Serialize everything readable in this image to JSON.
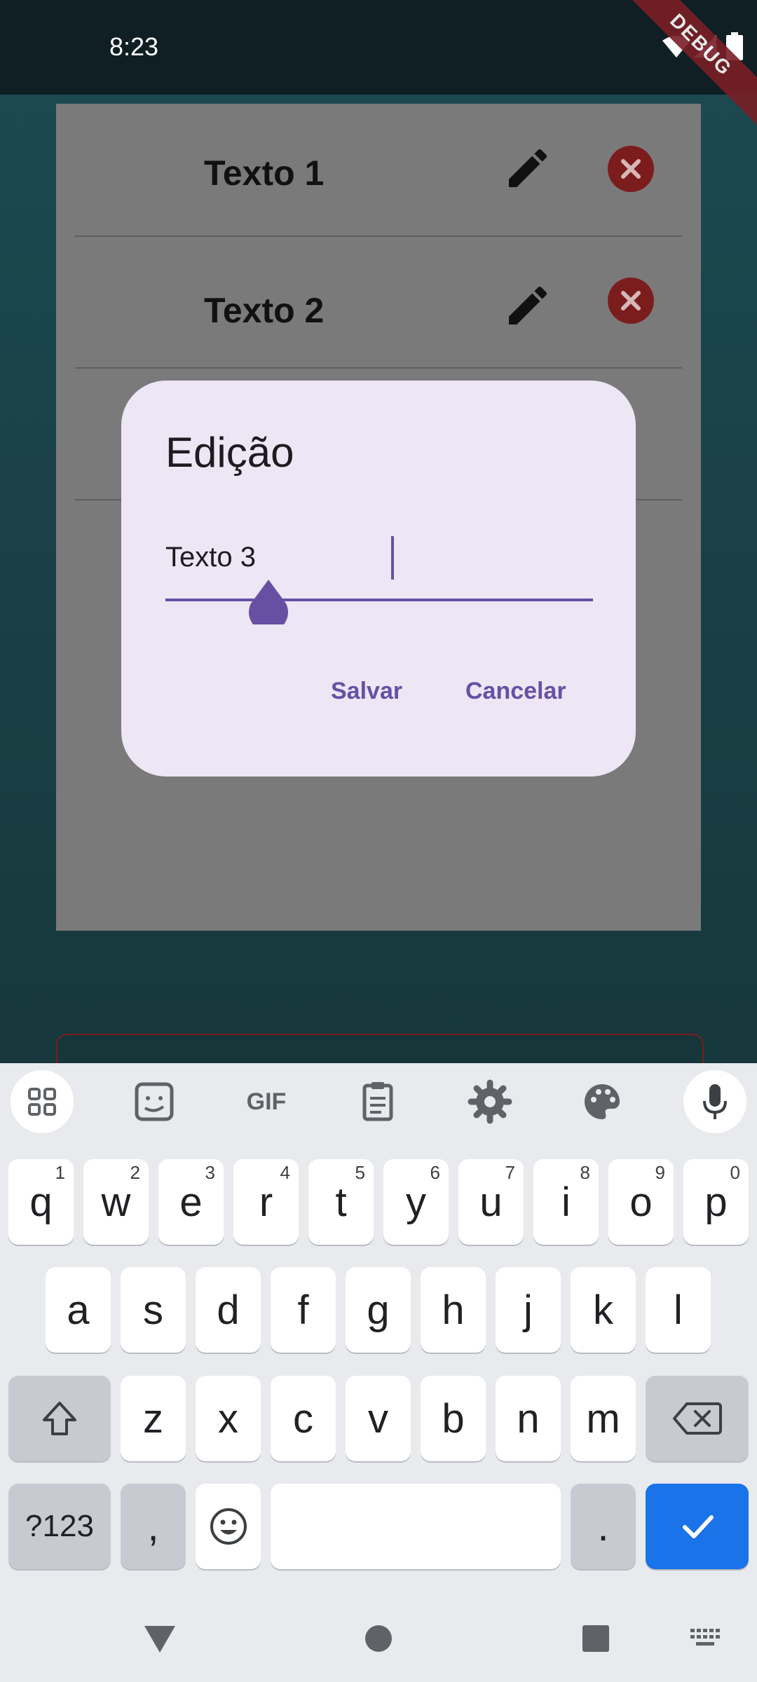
{
  "status_bar": {
    "time": "8:23",
    "debug_banner": "DEBUG"
  },
  "list": {
    "items": [
      {
        "title": "Texto 1"
      },
      {
        "title": "Texto 2"
      }
    ]
  },
  "dialog": {
    "title": "Edição",
    "input_value": "Texto 3",
    "save_label": "Salvar",
    "cancel_label": "Cancelar",
    "accent_color": "#6750a4"
  },
  "keyboard": {
    "toolbar": [
      "apps-icon",
      "sticker-icon",
      "gif-icon",
      "clipboard-icon",
      "settings-icon",
      "palette-icon",
      "mic-icon"
    ],
    "gif_label": "GIF",
    "row1": [
      {
        "key": "q",
        "hint": "1"
      },
      {
        "key": "w",
        "hint": "2"
      },
      {
        "key": "e",
        "hint": "3"
      },
      {
        "key": "r",
        "hint": "4"
      },
      {
        "key": "t",
        "hint": "5"
      },
      {
        "key": "y",
        "hint": "6"
      },
      {
        "key": "u",
        "hint": "7"
      },
      {
        "key": "i",
        "hint": "8"
      },
      {
        "key": "o",
        "hint": "9"
      },
      {
        "key": "p",
        "hint": "0"
      }
    ],
    "row2": [
      "a",
      "s",
      "d",
      "f",
      "g",
      "h",
      "j",
      "k",
      "l"
    ],
    "row3": [
      "z",
      "x",
      "c",
      "v",
      "b",
      "n",
      "m"
    ],
    "symbols_label": "?123",
    "comma_label": ",",
    "period_label": "."
  }
}
